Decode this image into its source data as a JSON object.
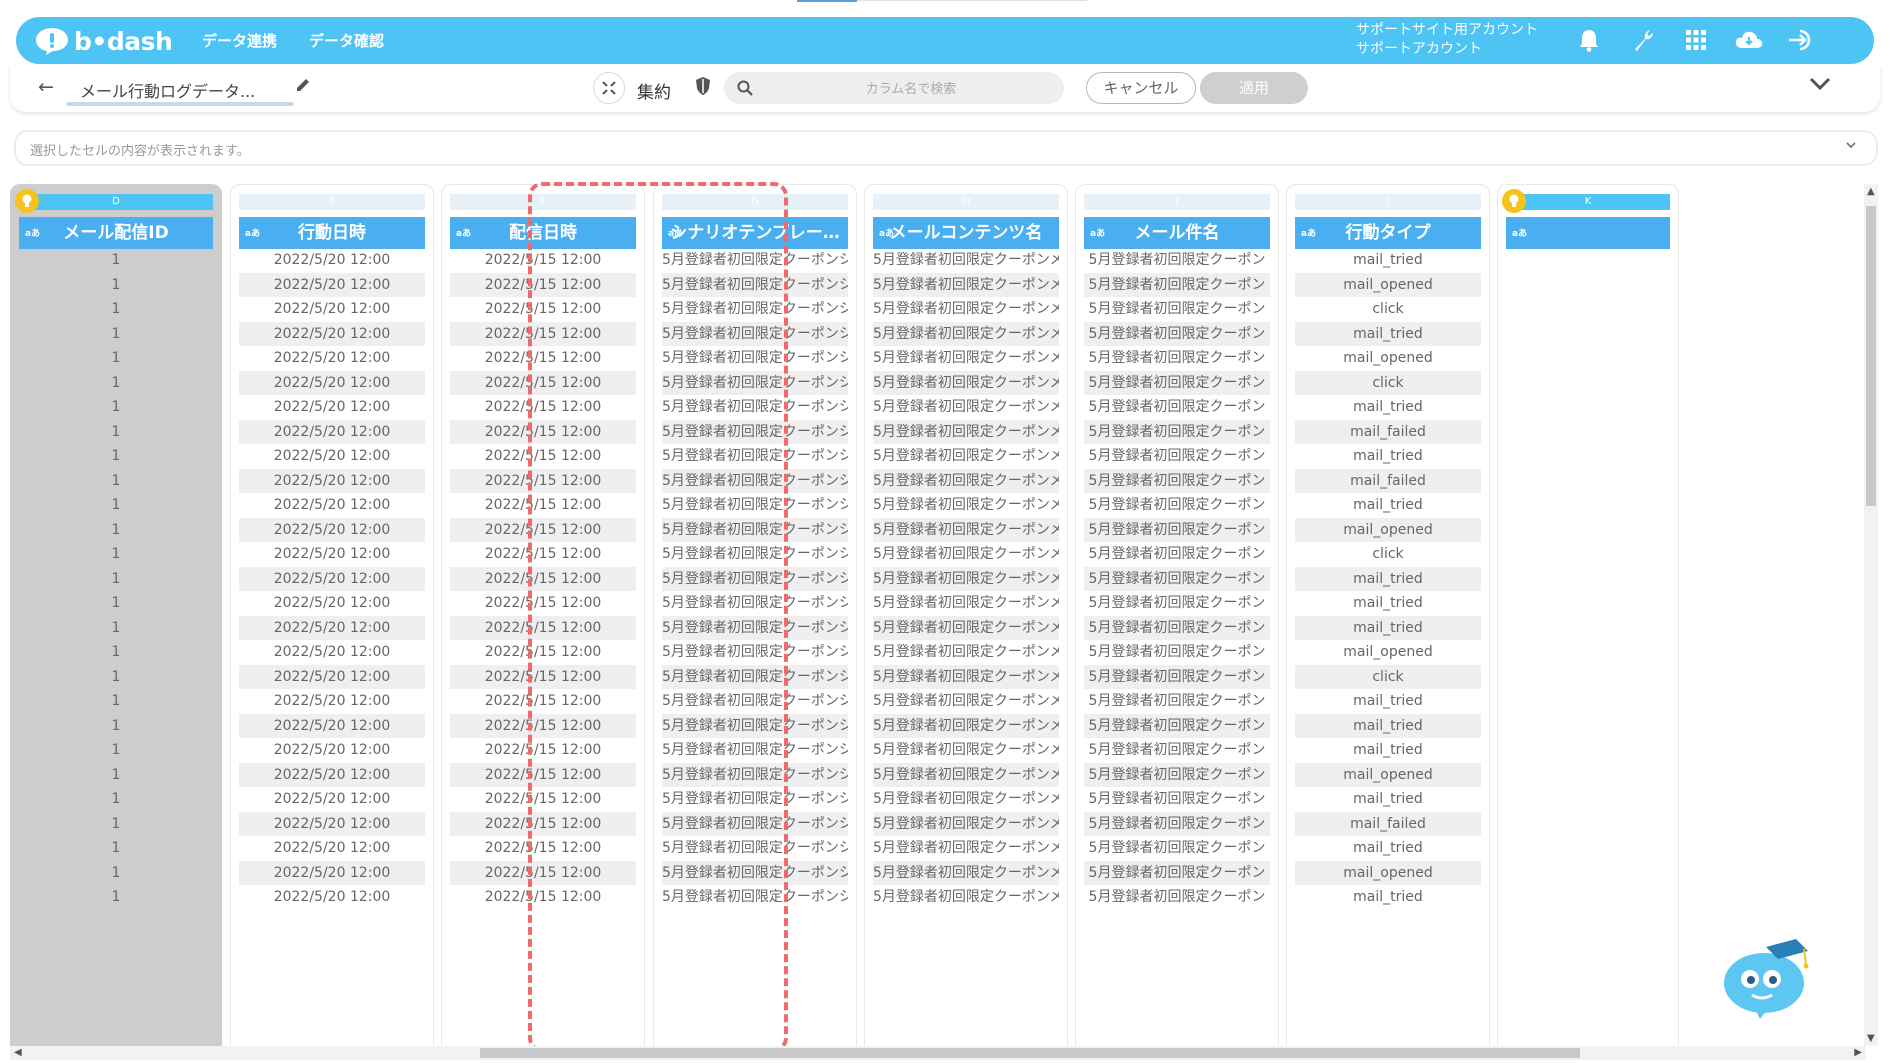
{
  "header": {
    "logo_text": "b•dash",
    "nav": [
      "データ連携",
      "データ確認"
    ],
    "account_line1": "サポートサイト用アカウント",
    "account_line2": "サポートアカウント",
    "icons": [
      "bell-icon",
      "wrench-icon",
      "grid-apps-icon",
      "cloud-download-icon",
      "logout-icon"
    ],
    "color": "#4dc4f4"
  },
  "toolbar": {
    "title": "メール行動ログデータ...",
    "aggregate_label": "集約",
    "search_placeholder": "カラム名で検索",
    "cancel_label": "キャンセル",
    "apply_label": "適用"
  },
  "preview": {
    "placeholder": "選択したセルの内容が表示されます。"
  },
  "grid": {
    "highlight_color": "#ee6b6b",
    "columns": [
      {
        "letter": "D",
        "name": "メール配信ID",
        "type": "aあ",
        "pinned": true,
        "selected": true
      },
      {
        "letter": "E",
        "name": "行動日時",
        "type": "aあ"
      },
      {
        "letter": "F",
        "name": "配信日時",
        "type": "aあ"
      },
      {
        "letter": "G",
        "name": "シナリオテンプレー…",
        "type": "aあ"
      },
      {
        "letter": "H",
        "name": "メールコンテンツ名",
        "type": "aあ"
      },
      {
        "letter": "I",
        "name": "メール件名",
        "type": "aあ"
      },
      {
        "letter": "J",
        "name": "行動タイプ",
        "type": "aあ"
      },
      {
        "letter": "K",
        "name": "",
        "type": "aあ",
        "pinned": true
      }
    ],
    "rows": [
      [
        "1",
        "2022/5/20 12:00",
        "2022/5/15 12:00",
        "5月登録者初回限定クーポンシ...",
        "5月登録者初回限定クーポンメ...",
        "5月登録者初回限定クーポン",
        "mail_tried"
      ],
      [
        "1",
        "2022/5/20 12:00",
        "2022/5/15 12:00",
        "5月登録者初回限定クーポンシ...",
        "5月登録者初回限定クーポンメ...",
        "5月登録者初回限定クーポン",
        "mail_opened"
      ],
      [
        "1",
        "2022/5/20 12:00",
        "2022/5/15 12:00",
        "5月登録者初回限定クーポンシ...",
        "5月登録者初回限定クーポンメ...",
        "5月登録者初回限定クーポン",
        "click"
      ],
      [
        "1",
        "2022/5/20 12:00",
        "2022/5/15 12:00",
        "5月登録者初回限定クーポンシ...",
        "5月登録者初回限定クーポンメ...",
        "5月登録者初回限定クーポン",
        "mail_tried"
      ],
      [
        "1",
        "2022/5/20 12:00",
        "2022/5/15 12:00",
        "5月登録者初回限定クーポンシ...",
        "5月登録者初回限定クーポンメ...",
        "5月登録者初回限定クーポン",
        "mail_opened"
      ],
      [
        "1",
        "2022/5/20 12:00",
        "2022/5/15 12:00",
        "5月登録者初回限定クーポンシ...",
        "5月登録者初回限定クーポンメ...",
        "5月登録者初回限定クーポン",
        "click"
      ],
      [
        "1",
        "2022/5/20 12:00",
        "2022/5/15 12:00",
        "5月登録者初回限定クーポンシ...",
        "5月登録者初回限定クーポンメ...",
        "5月登録者初回限定クーポン",
        "mail_tried"
      ],
      [
        "1",
        "2022/5/20 12:00",
        "2022/5/15 12:00",
        "5月登録者初回限定クーポンシ...",
        "5月登録者初回限定クーポンメ...",
        "5月登録者初回限定クーポン",
        "mail_failed"
      ],
      [
        "1",
        "2022/5/20 12:00",
        "2022/5/15 12:00",
        "5月登録者初回限定クーポンシ...",
        "5月登録者初回限定クーポンメ...",
        "5月登録者初回限定クーポン",
        "mail_tried"
      ],
      [
        "1",
        "2022/5/20 12:00",
        "2022/5/15 12:00",
        "5月登録者初回限定クーポンシ...",
        "5月登録者初回限定クーポンメ...",
        "5月登録者初回限定クーポン",
        "mail_failed"
      ],
      [
        "1",
        "2022/5/20 12:00",
        "2022/5/15 12:00",
        "5月登録者初回限定クーポンシ...",
        "5月登録者初回限定クーポンメ...",
        "5月登録者初回限定クーポン",
        "mail_tried"
      ],
      [
        "1",
        "2022/5/20 12:00",
        "2022/5/15 12:00",
        "5月登録者初回限定クーポンシ...",
        "5月登録者初回限定クーポンメ...",
        "5月登録者初回限定クーポン",
        "mail_opened"
      ],
      [
        "1",
        "2022/5/20 12:00",
        "2022/5/15 12:00",
        "5月登録者初回限定クーポンシ...",
        "5月登録者初回限定クーポンメ...",
        "5月登録者初回限定クーポン",
        "click"
      ],
      [
        "1",
        "2022/5/20 12:00",
        "2022/5/15 12:00",
        "5月登録者初回限定クーポンシ...",
        "5月登録者初回限定クーポンメ...",
        "5月登録者初回限定クーポン",
        "mail_tried"
      ],
      [
        "1",
        "2022/5/20 12:00",
        "2022/5/15 12:00",
        "5月登録者初回限定クーポンシ...",
        "5月登録者初回限定クーポンメ...",
        "5月登録者初回限定クーポン",
        "mail_tried"
      ],
      [
        "1",
        "2022/5/20 12:00",
        "2022/5/15 12:00",
        "5月登録者初回限定クーポンシ...",
        "5月登録者初回限定クーポンメ...",
        "5月登録者初回限定クーポン",
        "mail_tried"
      ],
      [
        "1",
        "2022/5/20 12:00",
        "2022/5/15 12:00",
        "5月登録者初回限定クーポンシ...",
        "5月登録者初回限定クーポンメ...",
        "5月登録者初回限定クーポン",
        "mail_opened"
      ],
      [
        "1",
        "2022/5/20 12:00",
        "2022/5/15 12:00",
        "5月登録者初回限定クーポンシ...",
        "5月登録者初回限定クーポンメ...",
        "5月登録者初回限定クーポン",
        "click"
      ],
      [
        "1",
        "2022/5/20 12:00",
        "2022/5/15 12:00",
        "5月登録者初回限定クーポンシ...",
        "5月登録者初回限定クーポンメ...",
        "5月登録者初回限定クーポン",
        "mail_tried"
      ],
      [
        "1",
        "2022/5/20 12:00",
        "2022/5/15 12:00",
        "5月登録者初回限定クーポンシ...",
        "5月登録者初回限定クーポンメ...",
        "5月登録者初回限定クーポン",
        "mail_tried"
      ],
      [
        "1",
        "2022/5/20 12:00",
        "2022/5/15 12:00",
        "5月登録者初回限定クーポンシ...",
        "5月登録者初回限定クーポンメ...",
        "5月登録者初回限定クーポン",
        "mail_tried"
      ],
      [
        "1",
        "2022/5/20 12:00",
        "2022/5/15 12:00",
        "5月登録者初回限定クーポンシ...",
        "5月登録者初回限定クーポンメ...",
        "5月登録者初回限定クーポン",
        "mail_opened"
      ],
      [
        "1",
        "2022/5/20 12:00",
        "2022/5/15 12:00",
        "5月登録者初回限定クーポンシ...",
        "5月登録者初回限定クーポンメ...",
        "5月登録者初回限定クーポン",
        "mail_tried"
      ],
      [
        "1",
        "2022/5/20 12:00",
        "2022/5/15 12:00",
        "5月登録者初回限定クーポンシ...",
        "5月登録者初回限定クーポンメ...",
        "5月登録者初回限定クーポン",
        "mail_failed"
      ],
      [
        "1",
        "2022/5/20 12:00",
        "2022/5/15 12:00",
        "5月登録者初回限定クーポンシ...",
        "5月登録者初回限定クーポンメ...",
        "5月登録者初回限定クーポン",
        "mail_tried"
      ],
      [
        "1",
        "2022/5/20 12:00",
        "2022/5/15 12:00",
        "5月登録者初回限定クーポンシ...",
        "5月登録者初回限定クーポンメ...",
        "5月登録者初回限定クーポン",
        "mail_opened"
      ],
      [
        "1",
        "2022/5/20 12:00",
        "2022/5/15 12:00",
        "5月登録者初回限定クーポンシ...",
        "5月登録者初回限定クーポンメ...",
        "5月登録者初回限定クーポン",
        "mail_tried"
      ]
    ]
  }
}
